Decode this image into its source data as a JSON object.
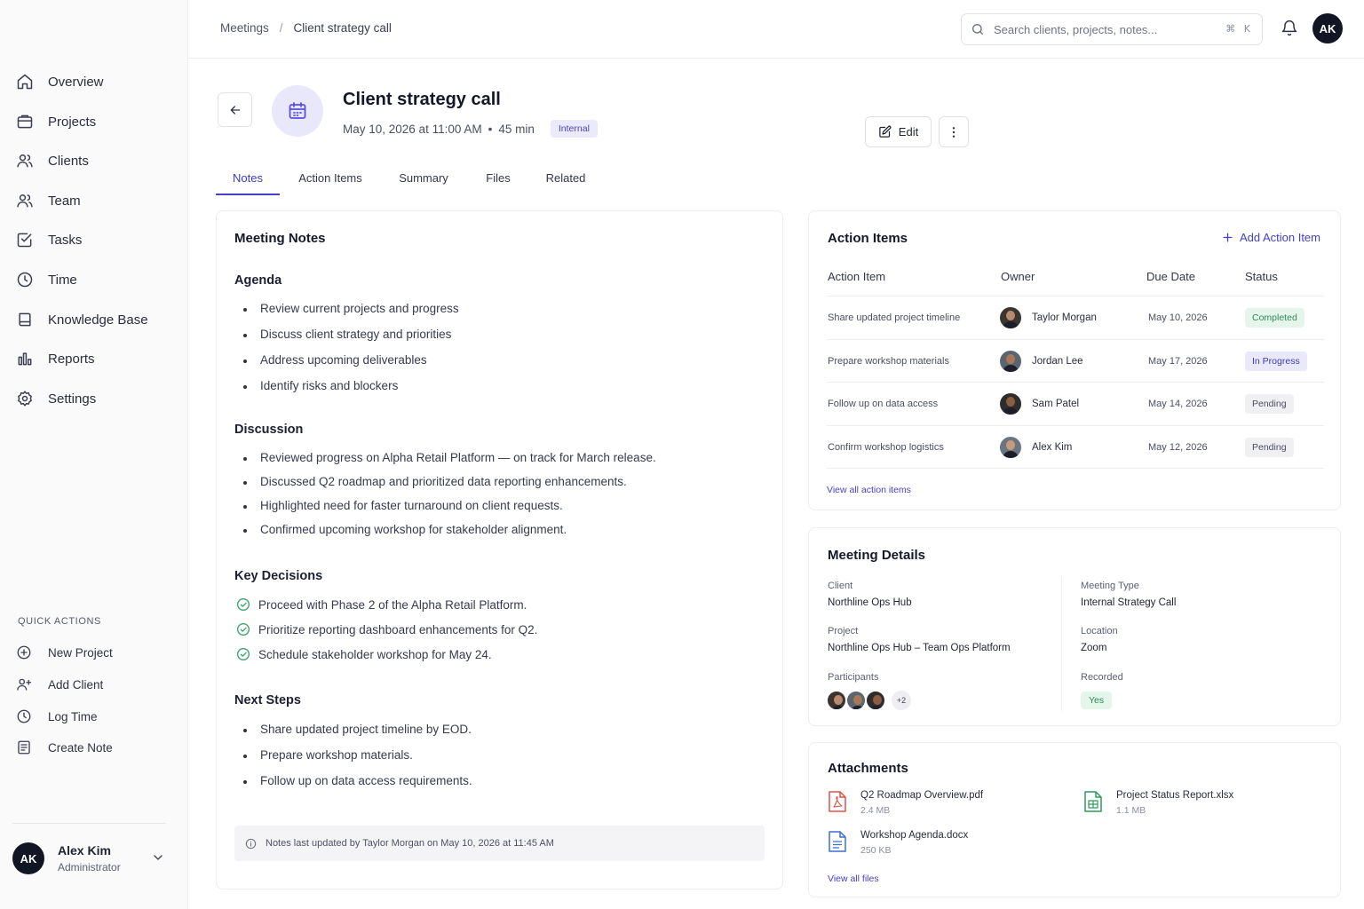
{
  "sidebar": {
    "nav": [
      {
        "label": "Overview",
        "icon": "home-icon"
      },
      {
        "label": "Projects",
        "icon": "folder-icon"
      },
      {
        "label": "Clients",
        "icon": "users-icon"
      },
      {
        "label": "Team",
        "icon": "team-icon"
      },
      {
        "label": "Tasks",
        "icon": "check-square-icon"
      },
      {
        "label": "Time",
        "icon": "clock-icon"
      },
      {
        "label": "Knowledge Base",
        "icon": "book-icon"
      },
      {
        "label": "Reports",
        "icon": "bar-chart-icon"
      },
      {
        "label": "Settings",
        "icon": "gear-icon"
      }
    ],
    "quick_actions_title": "QUICK ACTIONS",
    "quick_actions": [
      {
        "label": "New Project",
        "icon": "plus-circle-icon"
      },
      {
        "label": "Add Client",
        "icon": "user-plus-icon"
      },
      {
        "label": "Log Time",
        "icon": "clock-icon"
      },
      {
        "label": "Create Note",
        "icon": "note-icon"
      }
    ],
    "user": {
      "initials": "AK",
      "name": "Alex Kim",
      "role": "Administrator"
    }
  },
  "header": {
    "breadcrumb": [
      "Meetings",
      "Client strategy call"
    ],
    "breadcrumb_sep": "/",
    "search_placeholder": "Search clients, projects, notes...",
    "search_shortcut": "⌘ K",
    "avatar_initials": "AK"
  },
  "meeting": {
    "title": "Client strategy call",
    "date": "May 10, 2026 at 11:00 AM",
    "sep": "•",
    "duration": "45 min",
    "tag": "Internal",
    "edit_label": "Edit"
  },
  "tabs": [
    {
      "label": "Notes",
      "active": true
    },
    {
      "label": "Action Items",
      "active": false
    },
    {
      "label": "Summary",
      "active": false
    },
    {
      "label": "Files",
      "active": false
    },
    {
      "label": "Related",
      "active": false
    }
  ],
  "notes": {
    "title": "Meeting Notes",
    "agenda_title": "Agenda",
    "agenda": [
      "Review current projects and progress",
      "Discuss client strategy and priorities",
      "Address upcoming deliverables",
      "Identify risks and blockers"
    ],
    "discussion_title": "Discussion",
    "discussion": [
      "Reviewed progress on Alpha Retail Platform — on track for March release.",
      "Discussed Q2 roadmap and prioritized data reporting enhancements.",
      "Highlighted need for faster turnaround on client requests.",
      "Confirmed upcoming workshop for stakeholder alignment."
    ],
    "decisions_title": "Key Decisions",
    "decisions": [
      "Proceed with Phase 2 of the Alpha Retail Platform.",
      "Prioritize reporting dashboard enhancements for Q2.",
      "Schedule stakeholder workshop for May 24."
    ],
    "next_title": "Next Steps",
    "next_steps": [
      "Share updated project timeline by EOD.",
      "Prepare workshop materials.",
      "Follow up on data access requirements."
    ],
    "footer": "Notes last updated by Taylor Morgan on May 10, 2026 at 11:45 AM"
  },
  "action_items": {
    "title": "Action Items",
    "add_label": "Add Action Item",
    "columns": [
      "Action Item",
      "Owner",
      "Due Date",
      "Status"
    ],
    "rows": [
      {
        "item": "Share updated project timeline",
        "owner": "Taylor Morgan",
        "due": "May 10, 2026",
        "status": "Completed"
      },
      {
        "item": "Prepare workshop materials",
        "owner": "Jordan Lee",
        "due": "May 17, 2026",
        "status": "In Progress"
      },
      {
        "item": "Follow up on data access",
        "owner": "Sam Patel",
        "due": "May 14, 2026",
        "status": "Pending"
      },
      {
        "item": "Confirm workshop logistics",
        "owner": "Alex Kim",
        "due": "May 12, 2026",
        "status": "Pending"
      }
    ],
    "view_all": "View all action items"
  },
  "details": {
    "title": "Meeting Details",
    "client_label": "Client",
    "client": "Northline Ops Hub",
    "project_label": "Project",
    "project": "Northline Ops Hub – Team Ops Platform",
    "participants_label": "Participants",
    "participants_more": "+2",
    "type_label": "Meeting Type",
    "type": "Internal Strategy Call",
    "location_label": "Location",
    "location": "Zoom",
    "recorded_label": "Recorded",
    "recorded": "Yes"
  },
  "attachments": {
    "title": "Attachments",
    "files": [
      {
        "name": "Q2 Roadmap Overview.pdf",
        "size": "2.4 MB",
        "icon": "pdf-file-icon"
      },
      {
        "name": "Project Status Report.xlsx",
        "size": "1.1 MB",
        "icon": "spreadsheet-file-icon"
      },
      {
        "name": "Workshop Agenda.docx",
        "size": "250 KB",
        "icon": "doc-file-icon"
      }
    ],
    "view_all": "View all files"
  },
  "colors": {
    "accent": "#4540c9",
    "success": "#3aa46c",
    "dark": "#121624"
  }
}
